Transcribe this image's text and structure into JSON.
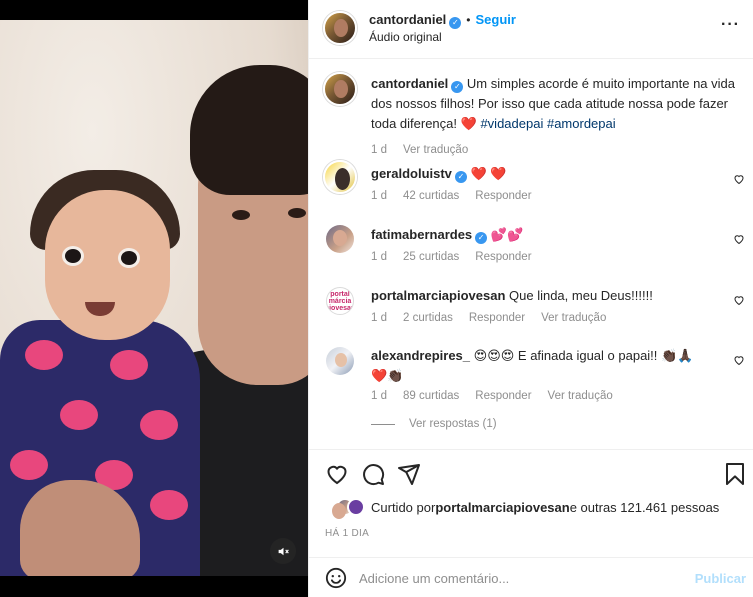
{
  "post": {
    "username": "cantordaniel",
    "follow_label": "Seguir",
    "audio": "Áudio original"
  },
  "caption": {
    "username": "cantordaniel",
    "text": "Um simples acorde é muito importante na vida dos nossos filhos! Por isso que cada atitude nossa pode fazer toda diferença!",
    "heart": "❤️",
    "hashtag_1": "#vidadepai",
    "hashtag_2": "#amordepai",
    "time": "1 d",
    "translate": "Ver tradução"
  },
  "comments": [
    {
      "username": "geraldoluistv",
      "text": "❤️ ❤️",
      "time": "1 d",
      "likes": "42 curtidas",
      "reply": "Responder"
    },
    {
      "username": "fatimabernardes",
      "text": "💕💕",
      "time": "1 d",
      "likes": "25 curtidas",
      "reply": "Responder"
    },
    {
      "username": "portalmarciapiovesan",
      "text": "Que linda, meu Deus!!!!!!",
      "time": "1 d",
      "likes": "2 curtidas",
      "reply": "Responder",
      "translate": "Ver tradução"
    },
    {
      "username": "alexandrepires_",
      "text": "😍😍😍 E afinada igual o papai!! 👏🏿🙏🏿",
      "text_line2": "❤️👏🏿",
      "time": "1 d",
      "likes": "89 curtidas",
      "reply": "Responder",
      "translate": "Ver tradução"
    }
  ],
  "view_replies": "Ver respostas (1)",
  "portal_avatar_text": "portal márcia piovesan",
  "likes_summary": {
    "prefix": "Curtido por ",
    "user": "portalmarciapiovesan",
    "suffix": " e outras 121.461 pessoas"
  },
  "date": "HÁ 1 DIA",
  "add_comment": {
    "placeholder": "Adicione um comentário...",
    "publish": "Publicar"
  },
  "icons": {
    "verified": "verified-badge-icon",
    "like": "heart-outline-icon",
    "comment": "comment-bubble-icon",
    "share": "paper-plane-icon",
    "save": "bookmark-icon",
    "emoji": "emoji-smiley-icon",
    "mute": "speaker-muted-icon",
    "more": "more-options-icon"
  },
  "colors": {
    "link_blue": "#0095f6",
    "verified_blue": "#3897f0",
    "hashtag": "#00376b",
    "muted_text": "#8e8e8e",
    "heart_red": "#ed4956",
    "publish_disabled": "#b2dffc"
  }
}
